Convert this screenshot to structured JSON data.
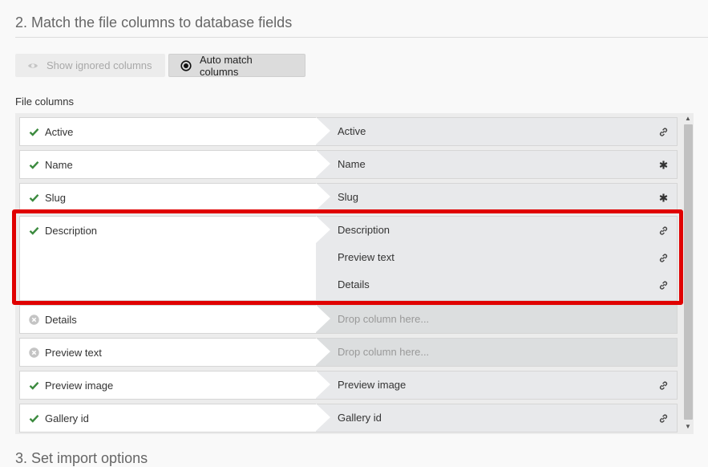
{
  "section": {
    "title": "2. Match the file columns to database fields",
    "next_title": "3. Set import options"
  },
  "toolbar": {
    "show_ignored_label": "Show ignored columns",
    "auto_match_label": "Auto match columns"
  },
  "file_columns_label": "File columns",
  "rows": [
    {
      "column": "Active",
      "status": "matched",
      "fields": [
        {
          "label": "Active",
          "icon": "link-icon"
        }
      ]
    },
    {
      "column": "Name",
      "status": "matched",
      "fields": [
        {
          "label": "Name",
          "icon": "required-asterisk-icon"
        }
      ]
    },
    {
      "column": "Slug",
      "status": "matched",
      "fields": [
        {
          "label": "Slug",
          "icon": "required-asterisk-icon"
        }
      ]
    },
    {
      "column": "Description",
      "status": "matched",
      "fields": [
        {
          "label": "Description",
          "icon": "link-icon"
        },
        {
          "label": "Preview text",
          "icon": "link-icon"
        },
        {
          "label": "Details",
          "icon": "link-icon"
        }
      ]
    },
    {
      "column": "Details",
      "status": "ignored",
      "placeholder": "Drop column here..."
    },
    {
      "column": "Preview text",
      "status": "ignored",
      "placeholder": "Drop column here..."
    },
    {
      "column": "Preview image",
      "status": "matched",
      "fields": [
        {
          "label": "Preview image",
          "icon": "link-icon"
        }
      ]
    },
    {
      "column": "Gallery id",
      "status": "matched",
      "fields": [
        {
          "label": "Gallery id",
          "icon": "link-icon"
        }
      ]
    }
  ],
  "colors": {
    "check": "#3b8a3e",
    "ignored": "#c4c4c4",
    "highlight": "#e00000"
  }
}
